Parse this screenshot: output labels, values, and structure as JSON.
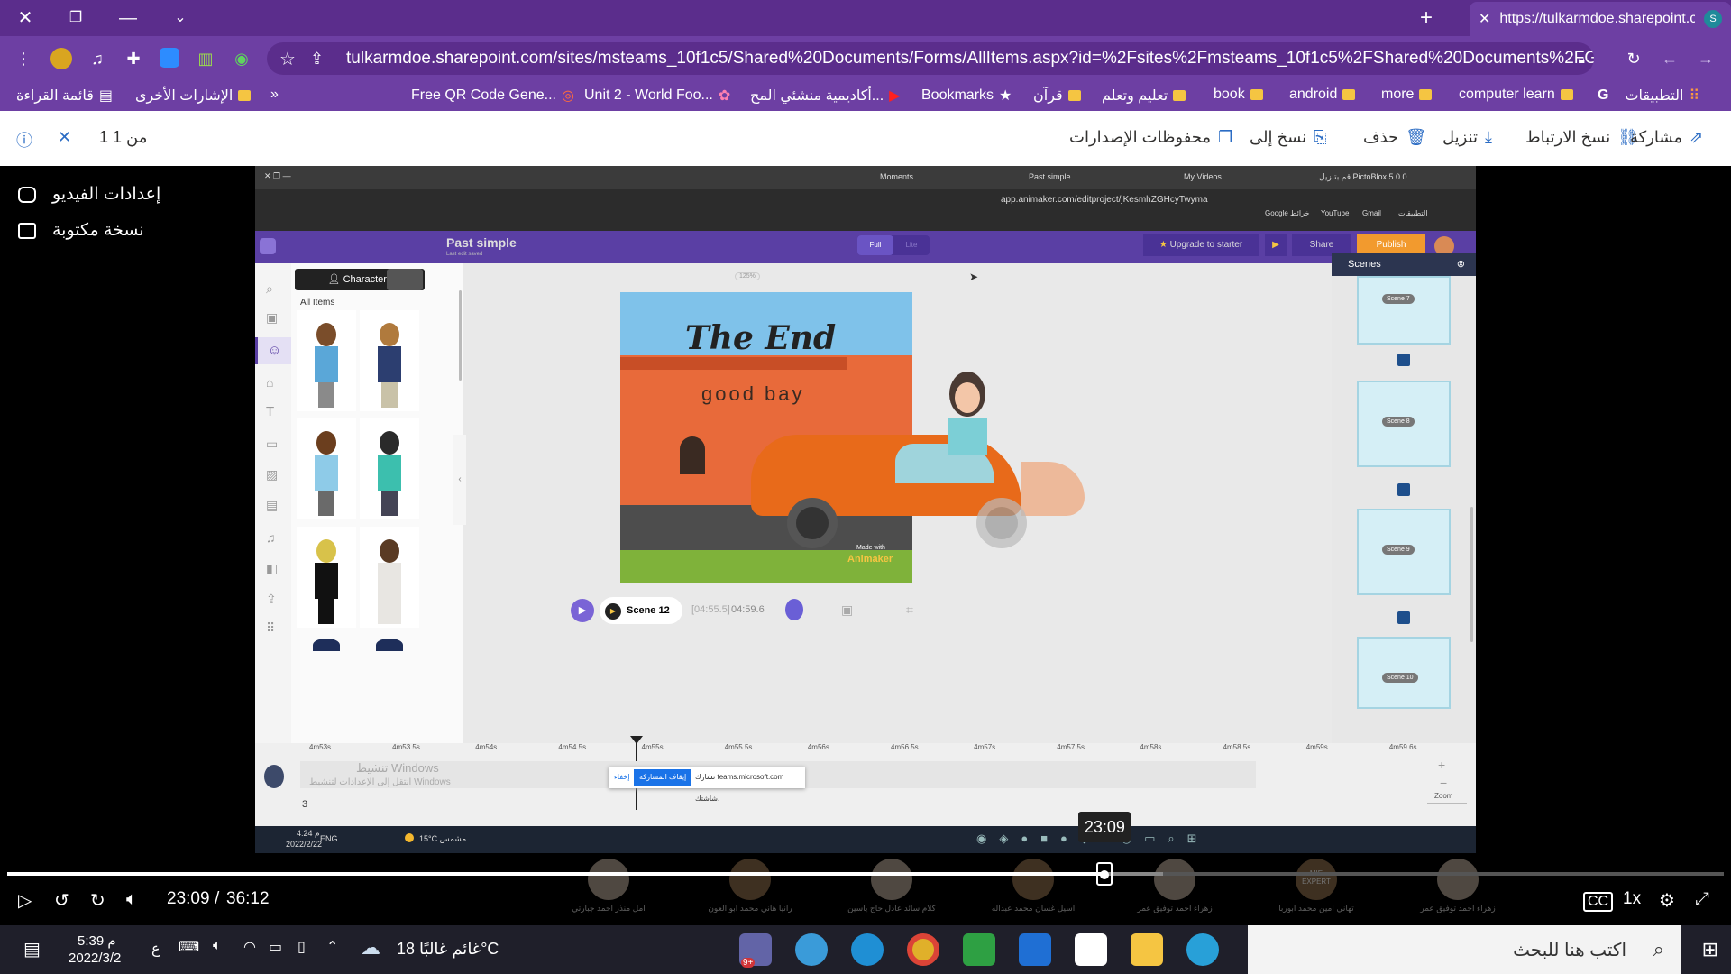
{
  "browser": {
    "tab_title": "https://tulkarmdoe.sharepoint.co",
    "url": "tulkarmdoe.sharepoint.com/sites/msteams_10f1c5/Shared%20Documents/Forms/AllItems.aspx?id=%2Fsites%2Fmsteams_10f1c5%2FShared%20Documents%2FGeneral%2FRe..."
  },
  "bookmarks": {
    "reading_list": "قائمة القراءة",
    "other_bookmarks": "الإشارات الأخرى",
    "overflow": "»",
    "items": [
      "Free QR Code Gene...",
      "Unit 2 - World Foo...",
      "أكاديمية منشئي المح...",
      "Bookmarks",
      "قرآن",
      "تعليم وتعلم",
      "book",
      "android",
      "more",
      "computer learn",
      "التطبيقات"
    ]
  },
  "commandbar": {
    "counter": "1 من 1",
    "share": "مشاركة",
    "copy_link": "نسخ الارتباط",
    "download": "تنزيل",
    "delete": "حذف",
    "copy_to": "نسخ إلى",
    "versions": "محفوظات الإصدارات"
  },
  "leftpanel": {
    "video_settings": "إعدادات الفيديو",
    "transcript": "نسخة مكتوبة"
  },
  "video": {
    "title_tabs": [
      "Moments",
      "Past simple",
      "My Videos",
      "قم بتنزيل PictoBlox 5.0.0"
    ],
    "address": "app.animaker.com/editproject/jKesmhZGHcyTwyma",
    "bookmarks_small": [
      "Google خرائط",
      "YouTube",
      "Gmail",
      "التطبيقات"
    ],
    "project_title": "Past simple",
    "project_sub": "Last edit saved",
    "mode_full": "Full",
    "mode_lite": "Lite",
    "upgrade": "Upgrade to starter",
    "share": "Share",
    "publish": "Publish",
    "characters_tab": "Characters",
    "all_items": "All Items",
    "zoom_badge": "125%",
    "scenes_title": "Scenes",
    "scenes": [
      "Scene 7",
      "Scene 8",
      "Scene 9",
      "Scene 10"
    ],
    "canvas_title": "The End",
    "canvas_sub": "good bay",
    "made_with": "Made with",
    "animaker": "Animaker",
    "scene_label": "Scene 12",
    "scene_time": "[04:55.5]",
    "scene_duration": "04:59.6",
    "timeline_ticks": [
      "4m53s",
      "4m53.5s",
      "4m54s",
      "4m54.5s",
      "4m55s",
      "4m55.5s",
      "4m56s",
      "4m56.5s",
      "4m57s",
      "4m57.5s",
      "4m58s",
      "4m58.5s",
      "4m59s",
      "4m59.6s"
    ],
    "zoom_label": "Zoom",
    "track_number": "3",
    "watermark_title": "تنشيط Windows",
    "watermark_sub": "انتقل إلى الإعدادات لتنشيط Windows",
    "share_bar_text": "تشارك teams.microsoft.com شاشتك.",
    "share_bar_stop": "إيقاف المشاركة",
    "share_bar_hide": "إخفاء",
    "taskbar_time": "4:24 م",
    "taskbar_date": "2022/2/22",
    "taskbar_lang": "ENG",
    "taskbar_weather": "15°C مشمس"
  },
  "player": {
    "current": "23:09",
    "separator": "/",
    "total": "36:12",
    "tooltip": "23:09",
    "progress": 0.6394,
    "buffered": 0.6732,
    "speed": "1x",
    "participants": [
      "امل منذر احمد جبارتي",
      "رانيا هاني محمد ابو العون",
      "كلام سائد عادل حاج ياسين",
      "اسيل غسان محمد عبداله",
      "زهراء احمد توفيق عمر",
      "تهاني امين محمد ابوربا",
      "زهراء احمد توفيق عمر"
    ],
    "participant_badge": "MIE EXPERT"
  },
  "taskbar": {
    "search_placeholder": "اكتب هنا للبحث",
    "weather": "غائم غالبًا  18°C",
    "time": "5:39 م",
    "date": "2022/3/2",
    "lang": "ع",
    "teams_badge": "9+"
  },
  "colors": {
    "chrome_purple": "#5b2d8c",
    "chrome_purple_light": "#6d3fa3",
    "sharepoint_blue": "#2b6cc4",
    "animaker_purple": "#5a3fa4",
    "publish_orange": "#f29a2e"
  }
}
